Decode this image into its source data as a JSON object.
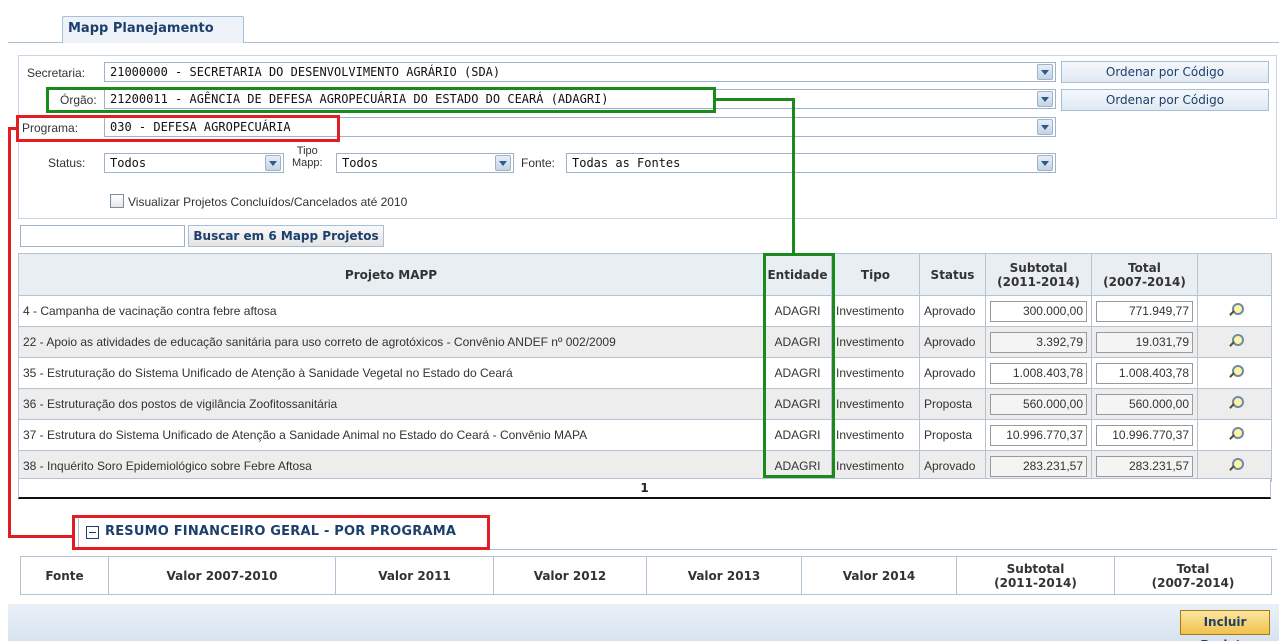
{
  "tab": {
    "label": "Mapp Planejamento"
  },
  "filters": {
    "secretaria_label": "Secretaria:",
    "secretaria_value": "21000000 - SECRETARIA DO DESENVOLVIMENTO AGRÁRIO (SDA)",
    "orgao_label": "Órgão:",
    "orgao_value": "21200011 - AGÊNCIA DE DEFESA AGROPECUÁRIA DO ESTADO DO CEARÁ (ADAGRI)",
    "programa_label": "Programa:",
    "programa_value": "030 - DEFESA AGROPECUÁRIA",
    "order_button_1": "Ordenar por Código",
    "order_button_2": "Ordenar por Código",
    "status_label": "Status:",
    "status_value": "Todos",
    "tipo_label_1": "Tipo",
    "tipo_label_2": "Mapp:",
    "tipo_value": "Todos",
    "fonte_label": "Fonte:",
    "fonte_value": "Todas as Fontes",
    "checkbox_label": "Visualizar Projetos Concluídos/Cancelados até 2010"
  },
  "search": {
    "input_value": "",
    "button_label": "Buscar em 6 Mapp Projetos"
  },
  "projects_table": {
    "headers": {
      "projeto": "Projeto MAPP",
      "entidade": "Entidade",
      "tipo": "Tipo",
      "status": "Status",
      "subtotal_1": "Subtotal",
      "subtotal_2": "(2011-2014)",
      "total_1": "Total",
      "total_2": "(2007-2014)"
    },
    "rows": [
      {
        "projeto": "4 - Campanha de vacinação contra febre aftosa",
        "entidade": "ADAGRI",
        "tipo": "Investimento",
        "status": "Aprovado",
        "subtotal": "300.000,00",
        "total": "771.949,77"
      },
      {
        "projeto": "22 - Apoio as atividades de educação sanitária para uso correto de agrotóxicos - Convênio ANDEF nº 002/2009",
        "entidade": "ADAGRI",
        "tipo": "Investimento",
        "status": "Aprovado",
        "subtotal": "3.392,79",
        "total": "19.031,79"
      },
      {
        "projeto": "35 - Estruturação do Sistema Unificado de Atenção à Sanidade Vegetal no Estado do Ceará",
        "entidade": "ADAGRI",
        "tipo": "Investimento",
        "status": "Aprovado",
        "subtotal": "1.008.403,78",
        "total": "1.008.403,78"
      },
      {
        "projeto": "36 - Estruturação dos postos de vigilância Zoofitossanitária",
        "entidade": "ADAGRI",
        "tipo": "Investimento",
        "status": "Proposta",
        "subtotal": "560.000,00",
        "total": "560.000,00"
      },
      {
        "projeto": "37 - Estrutura do Sistema Unificado de Atenção a Sanidade Animal no Estado do Ceará - Convênio MAPA",
        "entidade": "ADAGRI",
        "tipo": "Investimento",
        "status": "Proposta",
        "subtotal": "10.996.770,37",
        "total": "10.996.770,37"
      },
      {
        "projeto": "38 - Inquérito Soro Epidemiológico sobre Febre Aftosa",
        "entidade": "ADAGRI",
        "tipo": "Investimento",
        "status": "Aprovado",
        "subtotal": "283.231,57",
        "total": "283.231,57"
      }
    ],
    "page": "1"
  },
  "summary": {
    "title": "RESUMO FINANCEIRO GERAL - POR PROGRAMA",
    "headers": {
      "fonte": "Fonte",
      "v2007": "Valor 2007-2010",
      "v2011": "Valor 2011",
      "v2012": "Valor 2012",
      "v2013": "Valor 2013",
      "v2014": "Valor 2014",
      "subtotal_1": "Subtotal",
      "subtotal_2": "(2011-2014)",
      "total_1": "Total",
      "total_2": "(2007-2014)"
    }
  },
  "footer": {
    "incluir_label": "Incluir Projeto"
  },
  "colors": {
    "highlight_red": "#e31d24",
    "highlight_green": "#1a8a1d",
    "link_blue": "#1d3f6b"
  },
  "icons": {
    "row_action": "zoom-icon",
    "dropdown": "chevron-down-icon",
    "collapse": "minus-box-icon"
  }
}
